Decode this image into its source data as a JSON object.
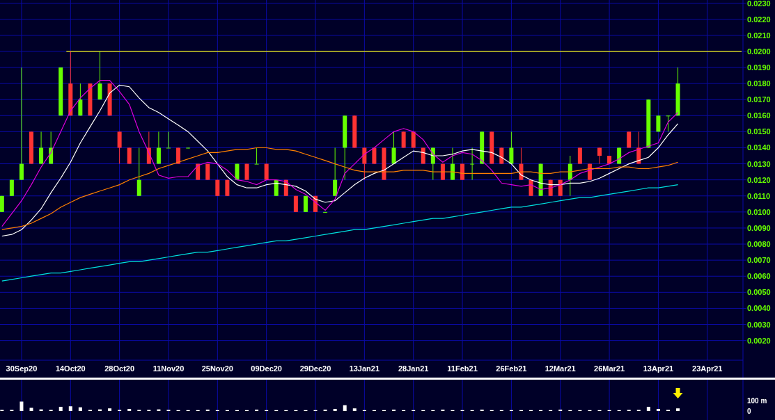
{
  "price_chart": {
    "chart_data": {
      "type": "line",
      "grid": true,
      "ylim": [
        0.0009,
        0.0232
      ],
      "categories": [
        null,
        null,
        "30Sep20",
        null,
        null,
        null,
        null,
        "14Oct20",
        null,
        null,
        null,
        null,
        "28Oct20",
        null,
        null,
        null,
        null,
        "11Nov20",
        null,
        null,
        null,
        null,
        "25Nov20",
        null,
        null,
        null,
        null,
        "09Dec20",
        null,
        null,
        null,
        null,
        "29Dec20",
        null,
        null,
        null,
        null,
        "13Jan21",
        null,
        null,
        null,
        null,
        "28Jan21",
        null,
        null,
        null,
        null,
        "11Feb21",
        null,
        null,
        null,
        null,
        "26Feb21",
        null,
        null,
        null,
        null,
        "12Mar21",
        null,
        null,
        null,
        null,
        "26Mar21",
        null,
        null,
        null,
        null,
        "13Apr21",
        null,
        null,
        null,
        null,
        "23Apr21"
      ],
      "yticks": [
        {
          "value": 0.023,
          "label": "0.0230"
        },
        {
          "value": 0.022,
          "label": "0.0220"
        },
        {
          "value": 0.021,
          "label": "0.0210"
        },
        {
          "value": 0.02,
          "label": "0.0200"
        },
        {
          "value": 0.019,
          "label": "0.0190"
        },
        {
          "value": 0.018,
          "label": "0.0180"
        },
        {
          "value": 0.017,
          "label": "0.0170"
        },
        {
          "value": 0.016,
          "label": "0.0160"
        },
        {
          "value": 0.015,
          "label": "0.0150"
        },
        {
          "value": 0.014,
          "label": "0.0140"
        },
        {
          "value": 0.013,
          "label": "0.0130"
        },
        {
          "value": 0.012,
          "label": "0.0120"
        },
        {
          "value": 0.011,
          "label": "0.0110"
        },
        {
          "value": 0.01,
          "label": "0.0100"
        },
        {
          "value": 0.009,
          "label": "0.0090"
        },
        {
          "value": 0.008,
          "label": "0.0080"
        },
        {
          "value": 0.007,
          "label": "0.0070"
        },
        {
          "value": 0.006,
          "label": "0.0060"
        },
        {
          "value": 0.005,
          "label": "0.0050"
        },
        {
          "value": 0.004,
          "label": "0.0040"
        },
        {
          "value": 0.003,
          "label": "0.0030"
        },
        {
          "value": 0.002,
          "label": "0.0020"
        }
      ],
      "ref_lines": [
        {
          "axis": "y",
          "value": 0.02,
          "color": "#ffff00"
        }
      ],
      "series": [
        {
          "color": "#ffffff",
          "values": [
            0.0085,
            0.0086,
            0.0089,
            0.0095,
            0.0102,
            0.0112,
            0.0121,
            0.0131,
            0.0143,
            0.0153,
            0.0163,
            0.0174,
            0.0179,
            0.0178,
            0.0171,
            0.0165,
            0.0162,
            0.0158,
            0.0154,
            0.015,
            0.0144,
            0.0138,
            0.013,
            0.0122,
            0.0117,
            0.0115,
            0.0115,
            0.0117,
            0.0118,
            0.0117,
            0.0116,
            0.0113,
            0.0108,
            0.0106,
            0.0107,
            0.0112,
            0.0117,
            0.0121,
            0.0124,
            0.0126,
            0.013,
            0.0134,
            0.0138,
            0.0137,
            0.0135,
            0.0135,
            0.0136,
            0.0138,
            0.0139,
            0.0138,
            0.0137,
            0.0134,
            0.013,
            0.0123,
            0.012,
            0.0118,
            0.0117,
            0.0117,
            0.0118,
            0.0118,
            0.0119,
            0.0121,
            0.0124,
            0.0127,
            0.013,
            0.0132,
            0.0134,
            0.014,
            0.0148,
            0.0155,
            null,
            null,
            null
          ]
        },
        {
          "color": "#dd00dd",
          "values": [
            0.0091,
            0.0099,
            0.0107,
            0.0117,
            0.0128,
            0.0137,
            0.015,
            0.0163,
            0.0171,
            0.0177,
            0.0182,
            0.0182,
            0.0175,
            0.0167,
            0.015,
            0.0137,
            0.0123,
            0.0121,
            0.0122,
            0.0122,
            0.0129,
            0.0131,
            0.013,
            0.0126,
            0.012,
            0.0119,
            0.0117,
            0.012,
            0.012,
            0.0119,
            0.0114,
            0.0111,
            0.0106,
            0.0101,
            0.0108,
            0.0124,
            0.013,
            0.0136,
            0.014,
            0.0145,
            0.015,
            0.0152,
            0.015,
            0.0145,
            0.0136,
            0.0131,
            0.0135,
            0.0137,
            0.0136,
            0.0132,
            0.0126,
            0.0118,
            0.0117,
            0.0116,
            0.0117,
            0.0114,
            0.0115,
            0.0117,
            0.012,
            0.0124,
            0.0126,
            0.0128,
            0.013,
            0.0133,
            0.0137,
            0.0139,
            0.0141,
            0.0143,
            0.0156,
            0.0162,
            null,
            null,
            null
          ]
        },
        {
          "color": "#ff8000",
          "values": [
            0.0089,
            0.009,
            0.0091,
            0.0093,
            0.0096,
            0.0099,
            0.0103,
            0.0106,
            0.0109,
            0.0111,
            0.0113,
            0.0115,
            0.0117,
            0.012,
            0.0122,
            0.0124,
            0.0127,
            0.0129,
            0.0131,
            0.0133,
            0.0135,
            0.0137,
            0.0137,
            0.0138,
            0.0139,
            0.0139,
            0.014,
            0.014,
            0.0139,
            0.0139,
            0.0138,
            0.0136,
            0.0134,
            0.0132,
            0.013,
            0.0128,
            0.0126,
            0.0125,
            0.0125,
            0.0125,
            0.0125,
            0.0126,
            0.0126,
            0.0126,
            0.0125,
            0.0125,
            0.0125,
            0.0124,
            0.0124,
            0.0124,
            0.0124,
            0.0124,
            0.0124,
            0.0125,
            0.0125,
            0.0124,
            0.0124,
            0.0125,
            0.0125,
            0.0126,
            0.0127,
            0.0127,
            0.0127,
            0.0128,
            0.0128,
            0.0127,
            0.0127,
            0.0128,
            0.0129,
            0.0131,
            null,
            null,
            null
          ]
        },
        {
          "color": "#00e0e0",
          "values": [
            0.0057,
            0.0058,
            0.0059,
            0.006,
            0.0061,
            0.0062,
            0.0062,
            0.0063,
            0.0064,
            0.0065,
            0.0066,
            0.0067,
            0.0068,
            0.0069,
            0.0069,
            0.007,
            0.0071,
            0.0072,
            0.0073,
            0.0074,
            0.0075,
            0.0075,
            0.0076,
            0.0077,
            0.0078,
            0.0079,
            0.008,
            0.0081,
            0.0082,
            0.0082,
            0.0083,
            0.0084,
            0.0085,
            0.0086,
            0.0087,
            0.0088,
            0.0089,
            0.0089,
            0.009,
            0.0091,
            0.0092,
            0.0093,
            0.0094,
            0.0095,
            0.0096,
            0.0096,
            0.0097,
            0.0098,
            0.0099,
            0.01,
            0.0101,
            0.0102,
            0.0103,
            0.0103,
            0.0104,
            0.0105,
            0.0106,
            0.0107,
            0.0108,
            0.0109,
            0.0109,
            0.011,
            0.0111,
            0.0112,
            0.0113,
            0.0114,
            0.0115,
            0.0115,
            0.0116,
            0.0117,
            null,
            null,
            null
          ]
        }
      ]
    }
  },
  "volume_chart": {
    "chart_data": {
      "type": "bar",
      "grid": true,
      "ylim": [
        0,
        300
      ],
      "categories": [
        null,
        null,
        null,
        null,
        null,
        null,
        null,
        null,
        null,
        null,
        null,
        null,
        null,
        null,
        null,
        null,
        null,
        null,
        null,
        null,
        null,
        null,
        null,
        null,
        null,
        null,
        null,
        null,
        null,
        null,
        null,
        null,
        null,
        null,
        null,
        null,
        null,
        null,
        null,
        null,
        null,
        null,
        null,
        null,
        null,
        null,
        null,
        null,
        null,
        null,
        null,
        null,
        null,
        null,
        null,
        null,
        null,
        null,
        null,
        null,
        null,
        null,
        null,
        null,
        null,
        null,
        null,
        null,
        null,
        null,
        null,
        null,
        null
      ],
      "yticks": [
        {
          "value": 100,
          "label": "100 m"
        },
        {
          "value": 0,
          "label": "0"
        }
      ],
      "series": [
        {
          "color": "#ffffff",
          "values": [
            10,
            10,
            90,
            30,
            15,
            10,
            40,
            45,
            35,
            10,
            15,
            25,
            10,
            20,
            10,
            10,
            15,
            10,
            8,
            8,
            8,
            12,
            8,
            8,
            8,
            8,
            12,
            8,
            8,
            8,
            8,
            8,
            8,
            12,
            20,
            55,
            25,
            8,
            8,
            8,
            12,
            8,
            8,
            8,
            8,
            12,
            8,
            8,
            8,
            12,
            8,
            8,
            8,
            8,
            8,
            8,
            8,
            12,
            8,
            8,
            8,
            8,
            8,
            8,
            10,
            10,
            40,
            20,
            10,
            25,
            null,
            null,
            null
          ]
        }
      ]
    }
  }
}
